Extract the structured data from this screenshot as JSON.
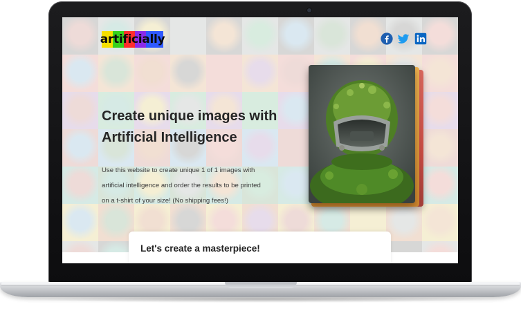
{
  "header": {
    "logo_text": "artificially",
    "logo_colors": [
      "#f6e000",
      "#37d11c",
      "#ff2d2d",
      "#8b2be8",
      "#2f59ff"
    ],
    "social": [
      {
        "icon": "facebook-icon",
        "color": "#1f5fb0"
      },
      {
        "icon": "twitter-icon",
        "color": "#1d9bf0"
      },
      {
        "icon": "linkedin-icon",
        "color": "#0a66c2"
      }
    ]
  },
  "hero": {
    "title_line1": "Create unique images with",
    "title_line2": "Artificial Intelligence",
    "description": "Use this website to create unique 1 of 1 images with artificial intelligence and order the results to be printed on a t-shirt of your size! (No shipping fees!)",
    "artwork": "moss-covered-helmet-image"
  },
  "card": {
    "title": "Let's create a masterpiece!"
  },
  "colors": {
    "text_dark": "#262626",
    "card_bg": "#ffffff"
  }
}
